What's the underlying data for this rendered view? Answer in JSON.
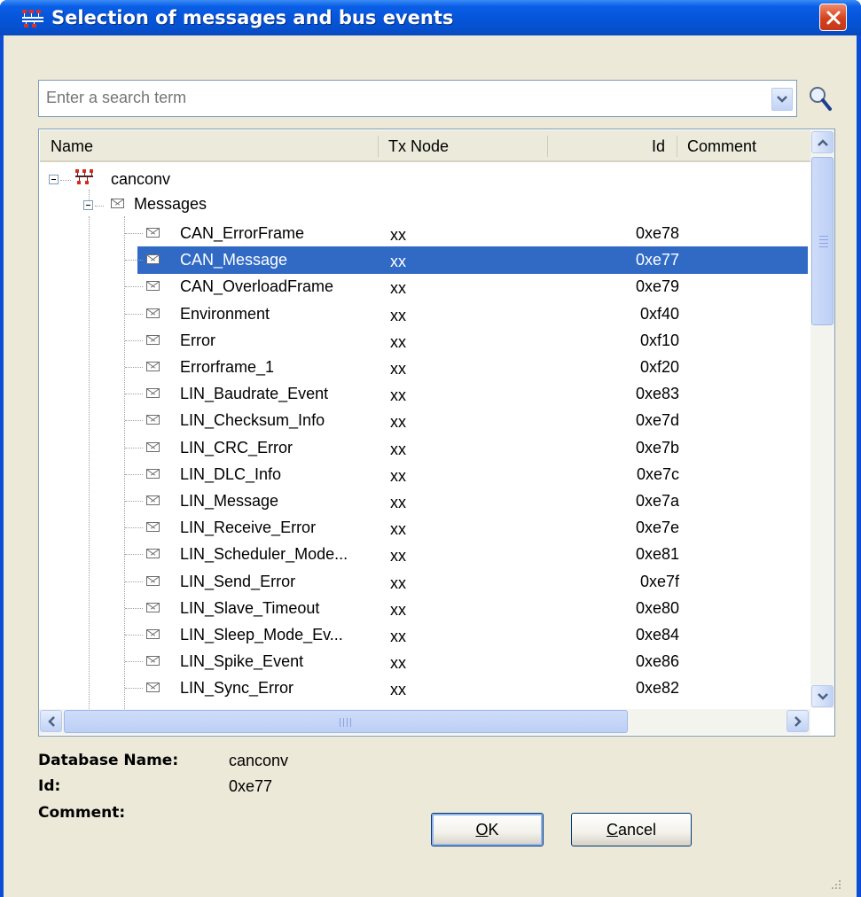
{
  "window": {
    "title": "Selection of messages and bus events",
    "icon": "network-bus-icon"
  },
  "search": {
    "placeholder": "Enter a search term"
  },
  "columns": {
    "name": "Name",
    "tx_node": "Tx Node",
    "id": "Id",
    "comment": "Comment"
  },
  "tree": {
    "root": "canconv",
    "group": "Messages",
    "messages": [
      {
        "name": "CAN_ErrorFrame",
        "tx": "xx",
        "id": "0xe78"
      },
      {
        "name": "CAN_Message",
        "tx": "xx",
        "id": "0xe77"
      },
      {
        "name": "CAN_OverloadFrame",
        "tx": "xx",
        "id": "0xe79"
      },
      {
        "name": "Environment",
        "tx": "xx",
        "id": "0xf40"
      },
      {
        "name": "Error",
        "tx": "xx",
        "id": "0xf10"
      },
      {
        "name": "Errorframe_1",
        "tx": "xx",
        "id": "0xf20"
      },
      {
        "name": "LIN_Baudrate_Event",
        "tx": "xx",
        "id": "0xe83"
      },
      {
        "name": "LIN_Checksum_Info",
        "tx": "xx",
        "id": "0xe7d"
      },
      {
        "name": "LIN_CRC_Error",
        "tx": "xx",
        "id": "0xe7b"
      },
      {
        "name": "LIN_DLC_Info",
        "tx": "xx",
        "id": "0xe7c"
      },
      {
        "name": "LIN_Message",
        "tx": "xx",
        "id": "0xe7a"
      },
      {
        "name": "LIN_Receive_Error",
        "tx": "xx",
        "id": "0xe7e"
      },
      {
        "name": "LIN_Scheduler_Mode...",
        "tx": "xx",
        "id": "0xe81"
      },
      {
        "name": "LIN_Send_Error",
        "tx": "xx",
        "id": "0xe7f"
      },
      {
        "name": "LIN_Slave_Timeout",
        "tx": "xx",
        "id": "0xe80"
      },
      {
        "name": "LIN_Sleep_Mode_Ev...",
        "tx": "xx",
        "id": "0xe84"
      },
      {
        "name": "LIN_Spike_Event",
        "tx": "xx",
        "id": "0xe86"
      },
      {
        "name": "LIN_Sync_Error",
        "tx": "xx",
        "id": "0xe82"
      }
    ],
    "selected_index": 1
  },
  "details": {
    "db_label": "Database Name:",
    "db_value": "canconv",
    "id_label": "Id:",
    "id_value": "0xe77",
    "comment_label": "Comment:",
    "comment_value": ""
  },
  "buttons": {
    "ok": "OK",
    "cancel": "Cancel"
  },
  "colors": {
    "title_bar": "#0654d9",
    "selection": "#316ac5",
    "dialog_bg": "#ece9d8",
    "close_button": "#d6411c"
  }
}
